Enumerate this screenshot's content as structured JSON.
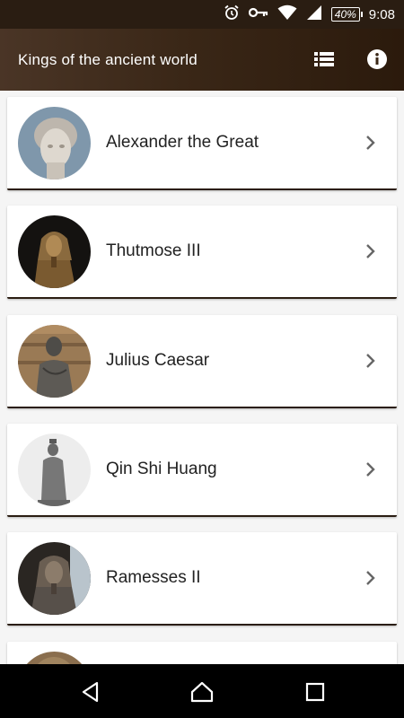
{
  "status_bar": {
    "time": "9:08",
    "battery": "40%",
    "icons": [
      "alarm-icon",
      "vpn-key-icon",
      "wifi-icon",
      "signal-icon",
      "battery-icon"
    ]
  },
  "app_bar": {
    "title": "Kings of the ancient world",
    "actions": [
      "list-view-icon",
      "info-icon"
    ]
  },
  "kings": [
    {
      "name": "Alexander the Great"
    },
    {
      "name": "Thutmose III"
    },
    {
      "name": "Julius Caesar"
    },
    {
      "name": "Qin Shi Huang"
    },
    {
      "name": "Ramesses II"
    },
    {
      "name": ""
    }
  ],
  "nav_bar": {
    "buttons": [
      "back-icon",
      "home-icon",
      "recents-icon"
    ]
  },
  "colors": {
    "app_bar": "#3a2717",
    "status_bar": "#2a1d12",
    "card_accent": "#2a1d12",
    "background": "#f5f5f5"
  }
}
